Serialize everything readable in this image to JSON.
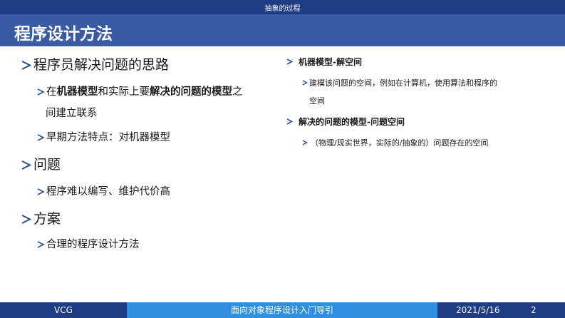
{
  "header": {
    "section_title": "抽象的过程"
  },
  "slide": {
    "title": "程序设计方法"
  },
  "left": {
    "p1": "程序员解决问题的思路",
    "p1_a": {
      "t1": "在",
      "b1": "机器模型",
      "t2": "和实际上要",
      "b2": "解决的问题的模型",
      "t3": "之",
      "t4": "间建立联系"
    },
    "p1_b": "早期方法特点：对机器模型",
    "p2": "问题",
    "p2_a": "程序难以编写、维护代价高",
    "p3": "方案",
    "p3_a": "合理的程序设计方法"
  },
  "right": {
    "r1": "机器模型-解空间",
    "r1_a": {
      "line1": "建模该问题的空间，例如在计算机，使用算法和程序的",
      "line2": "空间"
    },
    "r2": "解决的问题的模型-问题空间",
    "r2_a": "（物理/现实世界，实际的/抽象的）问题存在的空间"
  },
  "footer": {
    "left": "VCG",
    "center": "面向对象程序设计入门导引",
    "date": "2021/5/16",
    "page": "2"
  },
  "colors": {
    "header_dark": "#1f3d84",
    "title_bar": "#3a5aa4",
    "footer_accent": "#2f8fe0",
    "bullet": "#2d4f96"
  }
}
